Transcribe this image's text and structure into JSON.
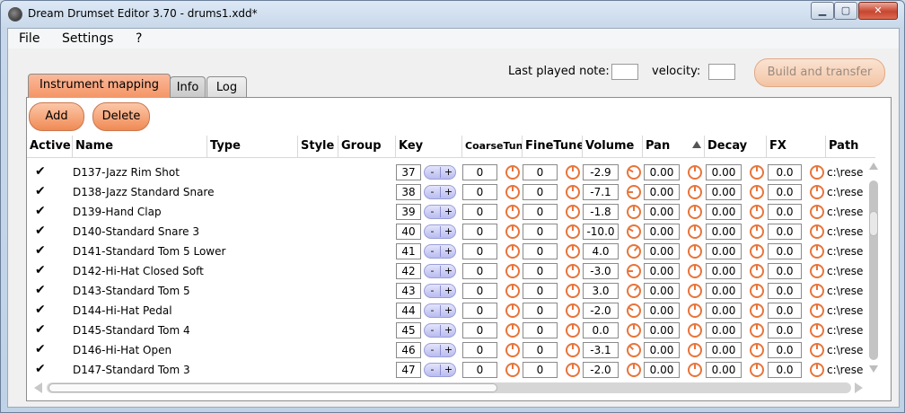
{
  "window": {
    "title": "Dream Drumset Editor 3.70 - drums1.xdd*",
    "min_glyph": "▁",
    "max_glyph": "▢",
    "close_glyph": "✕"
  },
  "menu": {
    "file": "File",
    "settings": "Settings",
    "help": "?"
  },
  "toparea": {
    "last_played_label": "Last played note:",
    "velocity_label": "velocity:",
    "build_label": "Build and transfer"
  },
  "tabs": {
    "mapping": "Instrument mapping",
    "info": "Info",
    "log": "Log"
  },
  "buttons": {
    "add": "Add",
    "delete": "Delete"
  },
  "columns": {
    "active": "Active",
    "name": "Name",
    "type": "Type",
    "style": "Style",
    "group": "Group",
    "key": "Key",
    "coarse": "CoarseTune",
    "fine": "FineTune",
    "volume": "Volume",
    "pan": "Pan",
    "decay": "Decay",
    "fx": "FX",
    "path": "Path"
  },
  "stepper": {
    "minus": "-",
    "plus": "+"
  },
  "check_glyph": "✔",
  "rows": [
    {
      "name": "D137-Jazz Rim Shot",
      "key": "37",
      "coarse": "0",
      "fine": "0",
      "volume": "-2.9",
      "pan": "0.00",
      "decay": "0.00",
      "fx": "0.0",
      "path": "c:\\rese"
    },
    {
      "name": "D138-Jazz Standard Snare",
      "key": "38",
      "coarse": "0",
      "fine": "0",
      "volume": "-7.1",
      "pan": "0.00",
      "decay": "0.00",
      "fx": "0.0",
      "path": "c:\\rese"
    },
    {
      "name": "D139-Hand Clap",
      "key": "39",
      "coarse": "0",
      "fine": "0",
      "volume": "-1.8",
      "pan": "0.00",
      "decay": "0.00",
      "fx": "0.0",
      "path": "c:\\rese"
    },
    {
      "name": "D140-Standard Snare 3",
      "key": "40",
      "coarse": "0",
      "fine": "0",
      "volume": "-10.0",
      "pan": "0.00",
      "decay": "0.00",
      "fx": "0.0",
      "path": "c:\\rese"
    },
    {
      "name": "D141-Standard Tom 5 Lower",
      "key": "41",
      "coarse": "0",
      "fine": "0",
      "volume": "4.0",
      "pan": "0.00",
      "decay": "0.00",
      "fx": "0.0",
      "path": "c:\\rese"
    },
    {
      "name": "D142-Hi-Hat Closed Soft",
      "key": "42",
      "coarse": "0",
      "fine": "0",
      "volume": "-3.0",
      "pan": "0.00",
      "decay": "0.00",
      "fx": "0.0",
      "path": "c:\\rese"
    },
    {
      "name": "D143-Standard Tom 5",
      "key": "43",
      "coarse": "0",
      "fine": "0",
      "volume": "3.0",
      "pan": "0.00",
      "decay": "0.00",
      "fx": "0.0",
      "path": "c:\\rese"
    },
    {
      "name": "D144-Hi-Hat Pedal",
      "key": "44",
      "coarse": "0",
      "fine": "0",
      "volume": "-2.0",
      "pan": "0.00",
      "decay": "0.00",
      "fx": "0.0",
      "path": "c:\\rese"
    },
    {
      "name": "D145-Standard Tom 4",
      "key": "45",
      "coarse": "0",
      "fine": "0",
      "volume": "0.0",
      "pan": "0.00",
      "decay": "0.00",
      "fx": "0.0",
      "path": "c:\\rese"
    },
    {
      "name": "D146-Hi-Hat Open",
      "key": "46",
      "coarse": "0",
      "fine": "0",
      "volume": "-3.1",
      "pan": "0.00",
      "decay": "0.00",
      "fx": "0.0",
      "path": "c:\\rese"
    },
    {
      "name": "D147-Standard Tom 3",
      "key": "47",
      "coarse": "0",
      "fine": "0",
      "volume": "-2.0",
      "pan": "0.00",
      "decay": "0.00",
      "fx": "0.0",
      "path": "c:\\rese"
    }
  ]
}
